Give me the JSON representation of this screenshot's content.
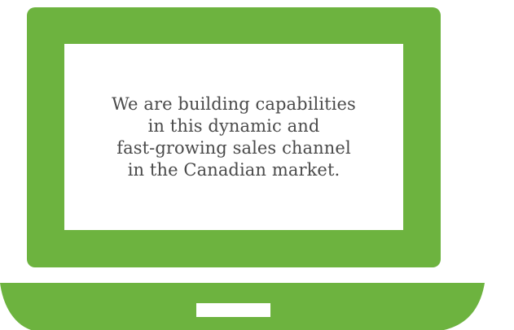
{
  "colors": {
    "laptop_body": "#6db33f",
    "screen": "#ffffff",
    "text": "#4a4a4a",
    "trackpad": "#ffffff"
  },
  "icons": {
    "laptop": "laptop-icon"
  },
  "message": {
    "lines": [
      "We are building capabilities",
      "in this dynamic and",
      "fast-growing sales channel",
      "in the Canadian market."
    ]
  }
}
